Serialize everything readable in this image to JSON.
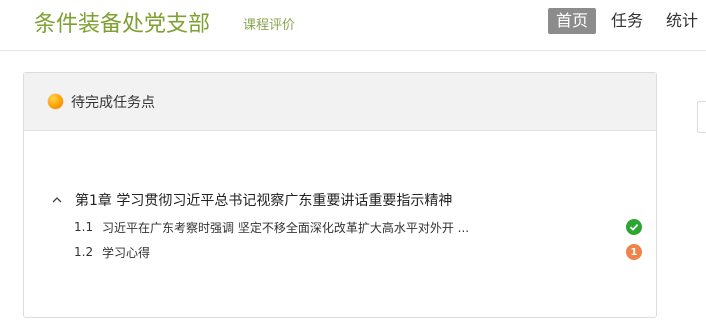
{
  "header": {
    "brand": "条件装备处党支部",
    "subtitle": "课程评价",
    "nav": [
      {
        "label": "首页",
        "active": true
      },
      {
        "label": "任务",
        "active": false
      },
      {
        "label": "统计",
        "active": false
      }
    ]
  },
  "panel": {
    "title": "待完成任务点",
    "chapter": {
      "title": "第1章 学习贯彻习近平总书记视察广东重要讲话重要指示精神",
      "items": [
        {
          "number": "1.1",
          "label": "习近平在广东考察时强调 坚定不移全面深化改革扩大高水平对外开 ...",
          "status": "completed",
          "status_icon": "check-icon"
        },
        {
          "number": "1.2",
          "label": "学习心得",
          "status": "pending",
          "badge": "1"
        }
      ]
    }
  },
  "colors": {
    "brand": "#7ea132",
    "nav_active_bg": "#8c8c8c",
    "completed": "#2aa631",
    "pending": "#f0824a"
  }
}
